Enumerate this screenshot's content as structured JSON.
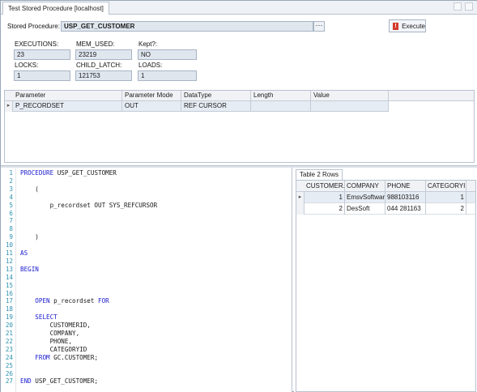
{
  "tab": {
    "title": "Test Stored Procedure [localhost]"
  },
  "form": {
    "stored_procedure_label": "Stored Procedure:",
    "stored_procedure_value": "USP_GET_CUSTOMER",
    "browse_label": "···",
    "execute_label": "Execute",
    "stats": {
      "executions_label": "EXECUTIONS:",
      "executions_value": "23",
      "mem_used_label": "MEM_USED:",
      "mem_used_value": "23219",
      "kept_label": "Kept?:",
      "kept_value": "NO",
      "locks_label": "LOCKS:",
      "locks_value": "1",
      "child_latch_label": "CHILD_LATCH:",
      "child_latch_value": "121753",
      "loads_label": "LOADS:",
      "loads_value": "1"
    }
  },
  "parameters": {
    "columns": [
      "Parameter",
      "Parameter Mode",
      "DataType",
      "Length",
      "Value"
    ],
    "rows": [
      {
        "parameter": "P_RECORDSET",
        "mode": "OUT",
        "datatype": "REF CURSOR",
        "length": "",
        "value": ""
      }
    ]
  },
  "editor": {
    "lines": [
      {
        "n": "1",
        "parts": [
          [
            "kw",
            "PROCEDURE"
          ],
          [
            "t",
            " USP_GET_CUSTOMER"
          ]
        ]
      },
      {
        "n": "2",
        "parts": []
      },
      {
        "n": "3",
        "parts": [
          [
            "t",
            "    ("
          ]
        ]
      },
      {
        "n": "4",
        "parts": []
      },
      {
        "n": "5",
        "parts": [
          [
            "t",
            "        p_recordset OUT SYS_REFCURSOR"
          ]
        ]
      },
      {
        "n": "6",
        "parts": []
      },
      {
        "n": "7",
        "parts": []
      },
      {
        "n": "8",
        "parts": []
      },
      {
        "n": "9",
        "parts": [
          [
            "t",
            "    )"
          ]
        ]
      },
      {
        "n": "10",
        "parts": []
      },
      {
        "n": "11",
        "parts": [
          [
            "kw",
            "AS"
          ]
        ]
      },
      {
        "n": "12",
        "parts": []
      },
      {
        "n": "13",
        "parts": [
          [
            "kw",
            "BEGIN"
          ]
        ]
      },
      {
        "n": "14",
        "parts": []
      },
      {
        "n": "15",
        "parts": []
      },
      {
        "n": "16",
        "parts": []
      },
      {
        "n": "17",
        "parts": [
          [
            "t",
            "    "
          ],
          [
            "kw",
            "OPEN"
          ],
          [
            "t",
            " p_recordset "
          ],
          [
            "kw",
            "FOR"
          ]
        ]
      },
      {
        "n": "18",
        "parts": []
      },
      {
        "n": "19",
        "parts": [
          [
            "t",
            "    "
          ],
          [
            "kw",
            "SELECT"
          ]
        ]
      },
      {
        "n": "20",
        "parts": [
          [
            "t",
            "        CUSTOMERID,"
          ]
        ]
      },
      {
        "n": "21",
        "parts": [
          [
            "t",
            "        COMPANY,"
          ]
        ]
      },
      {
        "n": "22",
        "parts": [
          [
            "t",
            "        PHONE,"
          ]
        ]
      },
      {
        "n": "23",
        "parts": [
          [
            "t",
            "        CATEGORYID"
          ]
        ]
      },
      {
        "n": "24",
        "parts": [
          [
            "t",
            "    "
          ],
          [
            "kw",
            "FROM"
          ],
          [
            "t",
            " GC.CUSTOMER;"
          ]
        ]
      },
      {
        "n": "25",
        "parts": []
      },
      {
        "n": "26",
        "parts": []
      },
      {
        "n": "27",
        "parts": [
          [
            "kw",
            "END"
          ],
          [
            "t",
            " USP_GET_CUSTOMER;"
          ]
        ]
      }
    ]
  },
  "results": {
    "tab_label": "Table 2 Rows",
    "columns": [
      "CUSTOMER...",
      "COMPANY",
      "PHONE",
      "CATEGORYID"
    ],
    "rows": [
      {
        "customerid": "1",
        "company": "EmsvSoftware",
        "phone": "988103116",
        "categoryid": "1"
      },
      {
        "customerid": "2",
        "company": "DesSoft",
        "phone": "044 281163",
        "categoryid": "2"
      }
    ]
  },
  "colors": {
    "keyword": "#1a1ad0",
    "line_number": "#2b91af",
    "execute_icon": "#d23a2a"
  },
  "icons": {
    "execute": "execute-icon",
    "row_indicator": "row-selector-icon"
  }
}
